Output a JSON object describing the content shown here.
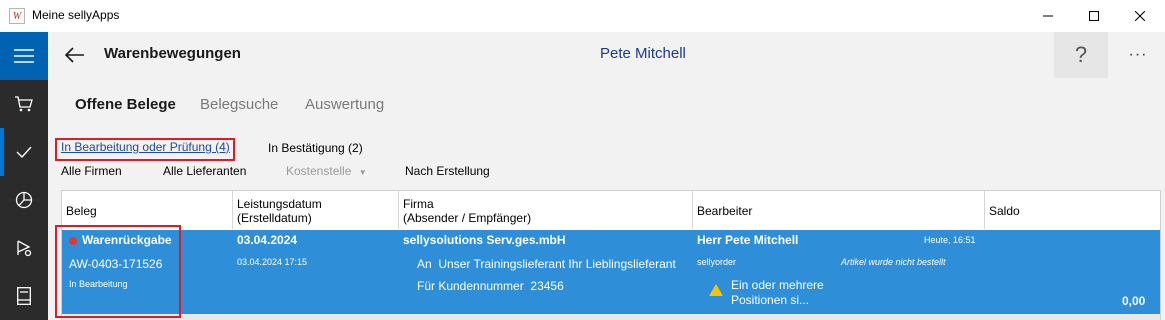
{
  "window": {
    "title": "Meine sellyApps",
    "app_icon": "W"
  },
  "sidebar": {
    "items": [
      {
        "icon": "hamburger-menu-icon"
      },
      {
        "icon": "cart-icon"
      },
      {
        "icon": "checkmark-icon"
      },
      {
        "icon": "pie-chart-icon"
      },
      {
        "icon": "routing-icon"
      },
      {
        "icon": "book-icon"
      }
    ]
  },
  "header": {
    "title": "Warenbewegungen",
    "user": "Pete Mitchell",
    "help": "?",
    "more": "···"
  },
  "tabs": [
    {
      "label": "Offene Belege"
    },
    {
      "label": "Belegsuche"
    },
    {
      "label": "Auswertung"
    }
  ],
  "filters": {
    "status": [
      {
        "label": "In Bearbeitung oder Prüfung (4)",
        "selected": true
      },
      {
        "label": "In Bestätigung (2)",
        "selected": false
      }
    ],
    "companies": "Alle Firmen",
    "suppliers": "Alle Lieferanten",
    "cost_center": "Kostenstelle",
    "sort": "Nach Erstellung"
  },
  "table": {
    "headers": {
      "beleg": "Beleg",
      "date_line1": "Leistungsdatum",
      "date_line2": "(Erstelldatum)",
      "firma_line1": "Firma",
      "firma_line2": "(Absender / Empfänger)",
      "bearbeiter": "Bearbeiter",
      "saldo": "Saldo"
    },
    "rows": [
      {
        "type": "Warenrückgabe",
        "number": "AW-0403-171526",
        "status": "In Bearbeitung",
        "service_date": "03.04.2024",
        "created": "03.04.2024 17:15",
        "company": "sellysolutions Serv.ges.mbH",
        "to_label": "An",
        "to_value": "Unser Trainingslieferant Ihr Lieblingslieferant",
        "customer_label": "Für Kundennummer",
        "customer_value": "23456",
        "editor": "Herr Pete Mitchell",
        "edited_time": "Heute, 16:51",
        "editor_app": "sellyorder",
        "note": "Artikel wurde nicht bestellt",
        "warning": "Ein oder mehrere Positionen si...",
        "saldo": "0,00"
      }
    ]
  },
  "colors": {
    "selected_row": "#2e8fd8",
    "sidebar": "#2b2b2b",
    "menu_button": "#0063b1",
    "highlight_border": "#d81f26",
    "status_dot": "#e5372c",
    "warning": "#f5c400"
  }
}
